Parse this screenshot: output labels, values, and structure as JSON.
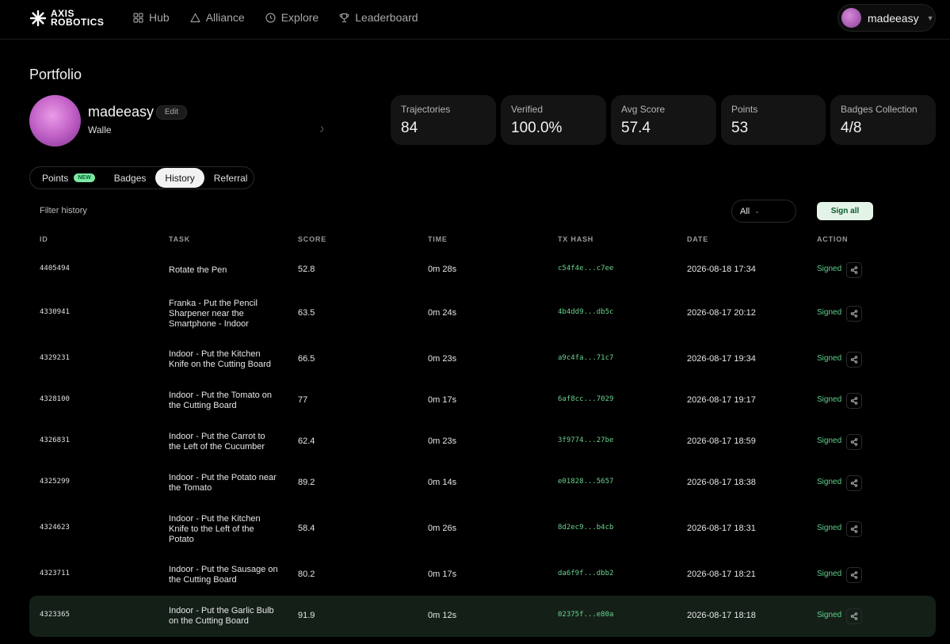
{
  "brand": {
    "line1": "AXIS",
    "line2": "ROBOTICS"
  },
  "nav": [
    {
      "label": "Hub",
      "icon": "grid-icon"
    },
    {
      "label": "Alliance",
      "icon": "triangle-icon"
    },
    {
      "label": "Explore",
      "icon": "compass-icon"
    },
    {
      "label": "Leaderboard",
      "icon": "trophy-icon"
    }
  ],
  "user": {
    "name": "madeeasy"
  },
  "page": {
    "title": "Portfolio"
  },
  "profile": {
    "name": "madeeasy",
    "edit_label": "Edit",
    "wallet_label": "Wallet"
  },
  "stats": [
    {
      "label": "Trajectories",
      "value": "84"
    },
    {
      "label": "Verified",
      "value": "100.0%"
    },
    {
      "label": "Avg Score",
      "value": "57.4"
    },
    {
      "label": "Points",
      "value": "53"
    },
    {
      "label": "Badges Collection",
      "value": "4/8"
    }
  ],
  "tabs": [
    {
      "label": "Points",
      "badge": "NEW"
    },
    {
      "label": "Badges"
    },
    {
      "label": "History",
      "active": true
    },
    {
      "label": "Referral"
    }
  ],
  "filter": {
    "label": "Filter history",
    "value": "All"
  },
  "sign_all_label": "Sign all",
  "table": {
    "headers": [
      "ID",
      "TASK",
      "SCORE",
      "TIME",
      "TX HASH",
      "DATE",
      "ACTION"
    ],
    "rows": [
      {
        "id": "4405494",
        "task": "Rotate the Pen",
        "score": "52.8",
        "time": "0m 28s",
        "hash": "c54f4e...c7ee",
        "date": "2026-08-18 17:34",
        "action": "Signed"
      },
      {
        "id": "4330941",
        "task": "Franka - Put the Pencil Sharpener near the Smartphone - Indoor",
        "score": "63.5",
        "time": "0m 24s",
        "hash": "4b4dd9...db5c",
        "date": "2026-08-17 20:12",
        "action": "Signed"
      },
      {
        "id": "4329231",
        "task": "Indoor - Put the Kitchen Knife on the Cutting Board",
        "score": "66.5",
        "time": "0m 23s",
        "hash": "a9c4fa...71c7",
        "date": "2026-08-17 19:34",
        "action": "Signed"
      },
      {
        "id": "4328100",
        "task": "Indoor - Put the Tomato on the Cutting Board",
        "score": "77",
        "time": "0m 17s",
        "hash": "6af8cc...7029",
        "date": "2026-08-17 19:17",
        "action": "Signed"
      },
      {
        "id": "4326831",
        "task": "Indoor - Put the Carrot to the Left of the Cucumber",
        "score": "62.4",
        "time": "0m 23s",
        "hash": "3f9774...27be",
        "date": "2026-08-17 18:59",
        "action": "Signed"
      },
      {
        "id": "4325299",
        "task": "Indoor - Put the Potato near the Tomato",
        "score": "89.2",
        "time": "0m 14s",
        "hash": "e01828...5657",
        "date": "2026-08-17 18:38",
        "action": "Signed"
      },
      {
        "id": "4324623",
        "task": "Indoor - Put the Kitchen Knife to the Left of the Potato",
        "score": "58.4",
        "time": "0m 26s",
        "hash": "8d2ec9...b4cb",
        "date": "2026-08-17 18:31",
        "action": "Signed"
      },
      {
        "id": "4323711",
        "task": "Indoor - Put the Sausage on the Cutting Board",
        "score": "80.2",
        "time": "0m 17s",
        "hash": "da6f9f...dbb2",
        "date": "2026-08-17 18:21",
        "action": "Signed"
      },
      {
        "id": "4323365",
        "task": "Indoor - Put the Garlic Bulb on the Cutting Board",
        "score": "91.9",
        "time": "0m 12s",
        "hash": "02375f...e80a",
        "date": "2026-08-17 18:18",
        "action": "Signed"
      }
    ]
  }
}
